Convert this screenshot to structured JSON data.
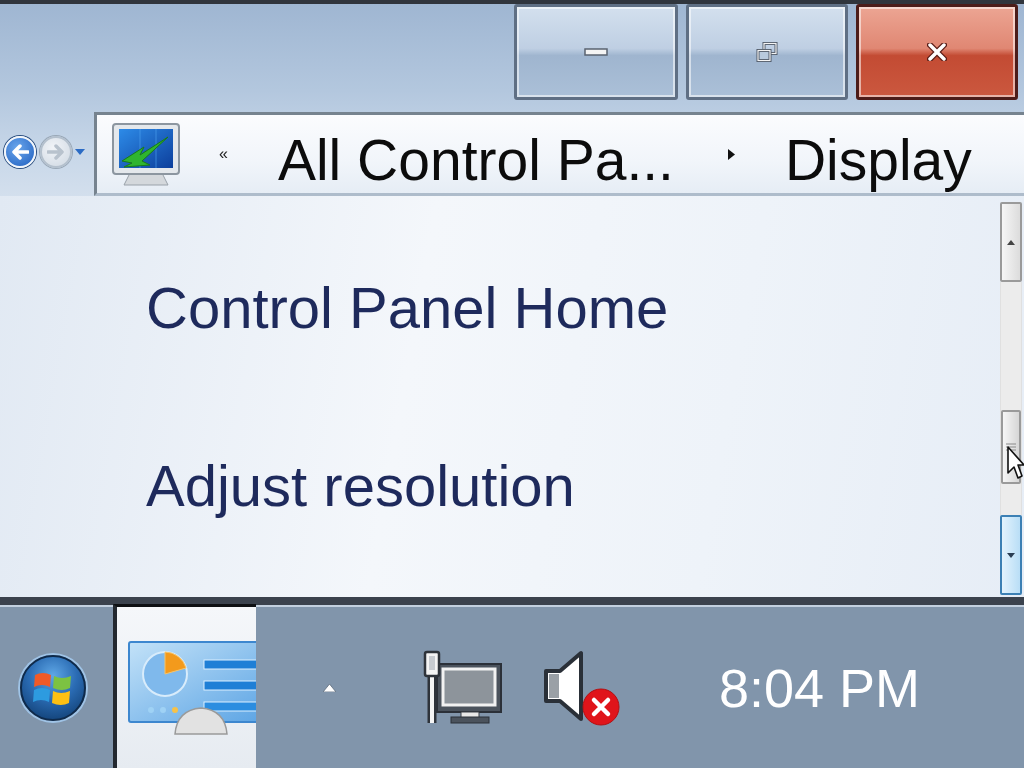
{
  "navigation": {
    "back": {
      "disabled": false
    },
    "forward": {
      "disabled": true
    }
  },
  "address_bar": {
    "overflow_mark": "«",
    "breadcrumbs": [
      "All Control Pa...",
      "Display"
    ]
  },
  "sidebar": {
    "links": [
      "Control Panel Home",
      "Adjust resolution"
    ]
  },
  "scrollbar": {
    "down_button": {
      "hovered": true
    }
  },
  "taskbar": {
    "apps": [
      {
        "selected": true
      }
    ],
    "tray": {
      "volume_muted": true
    },
    "clock": "8:04 PM"
  }
}
